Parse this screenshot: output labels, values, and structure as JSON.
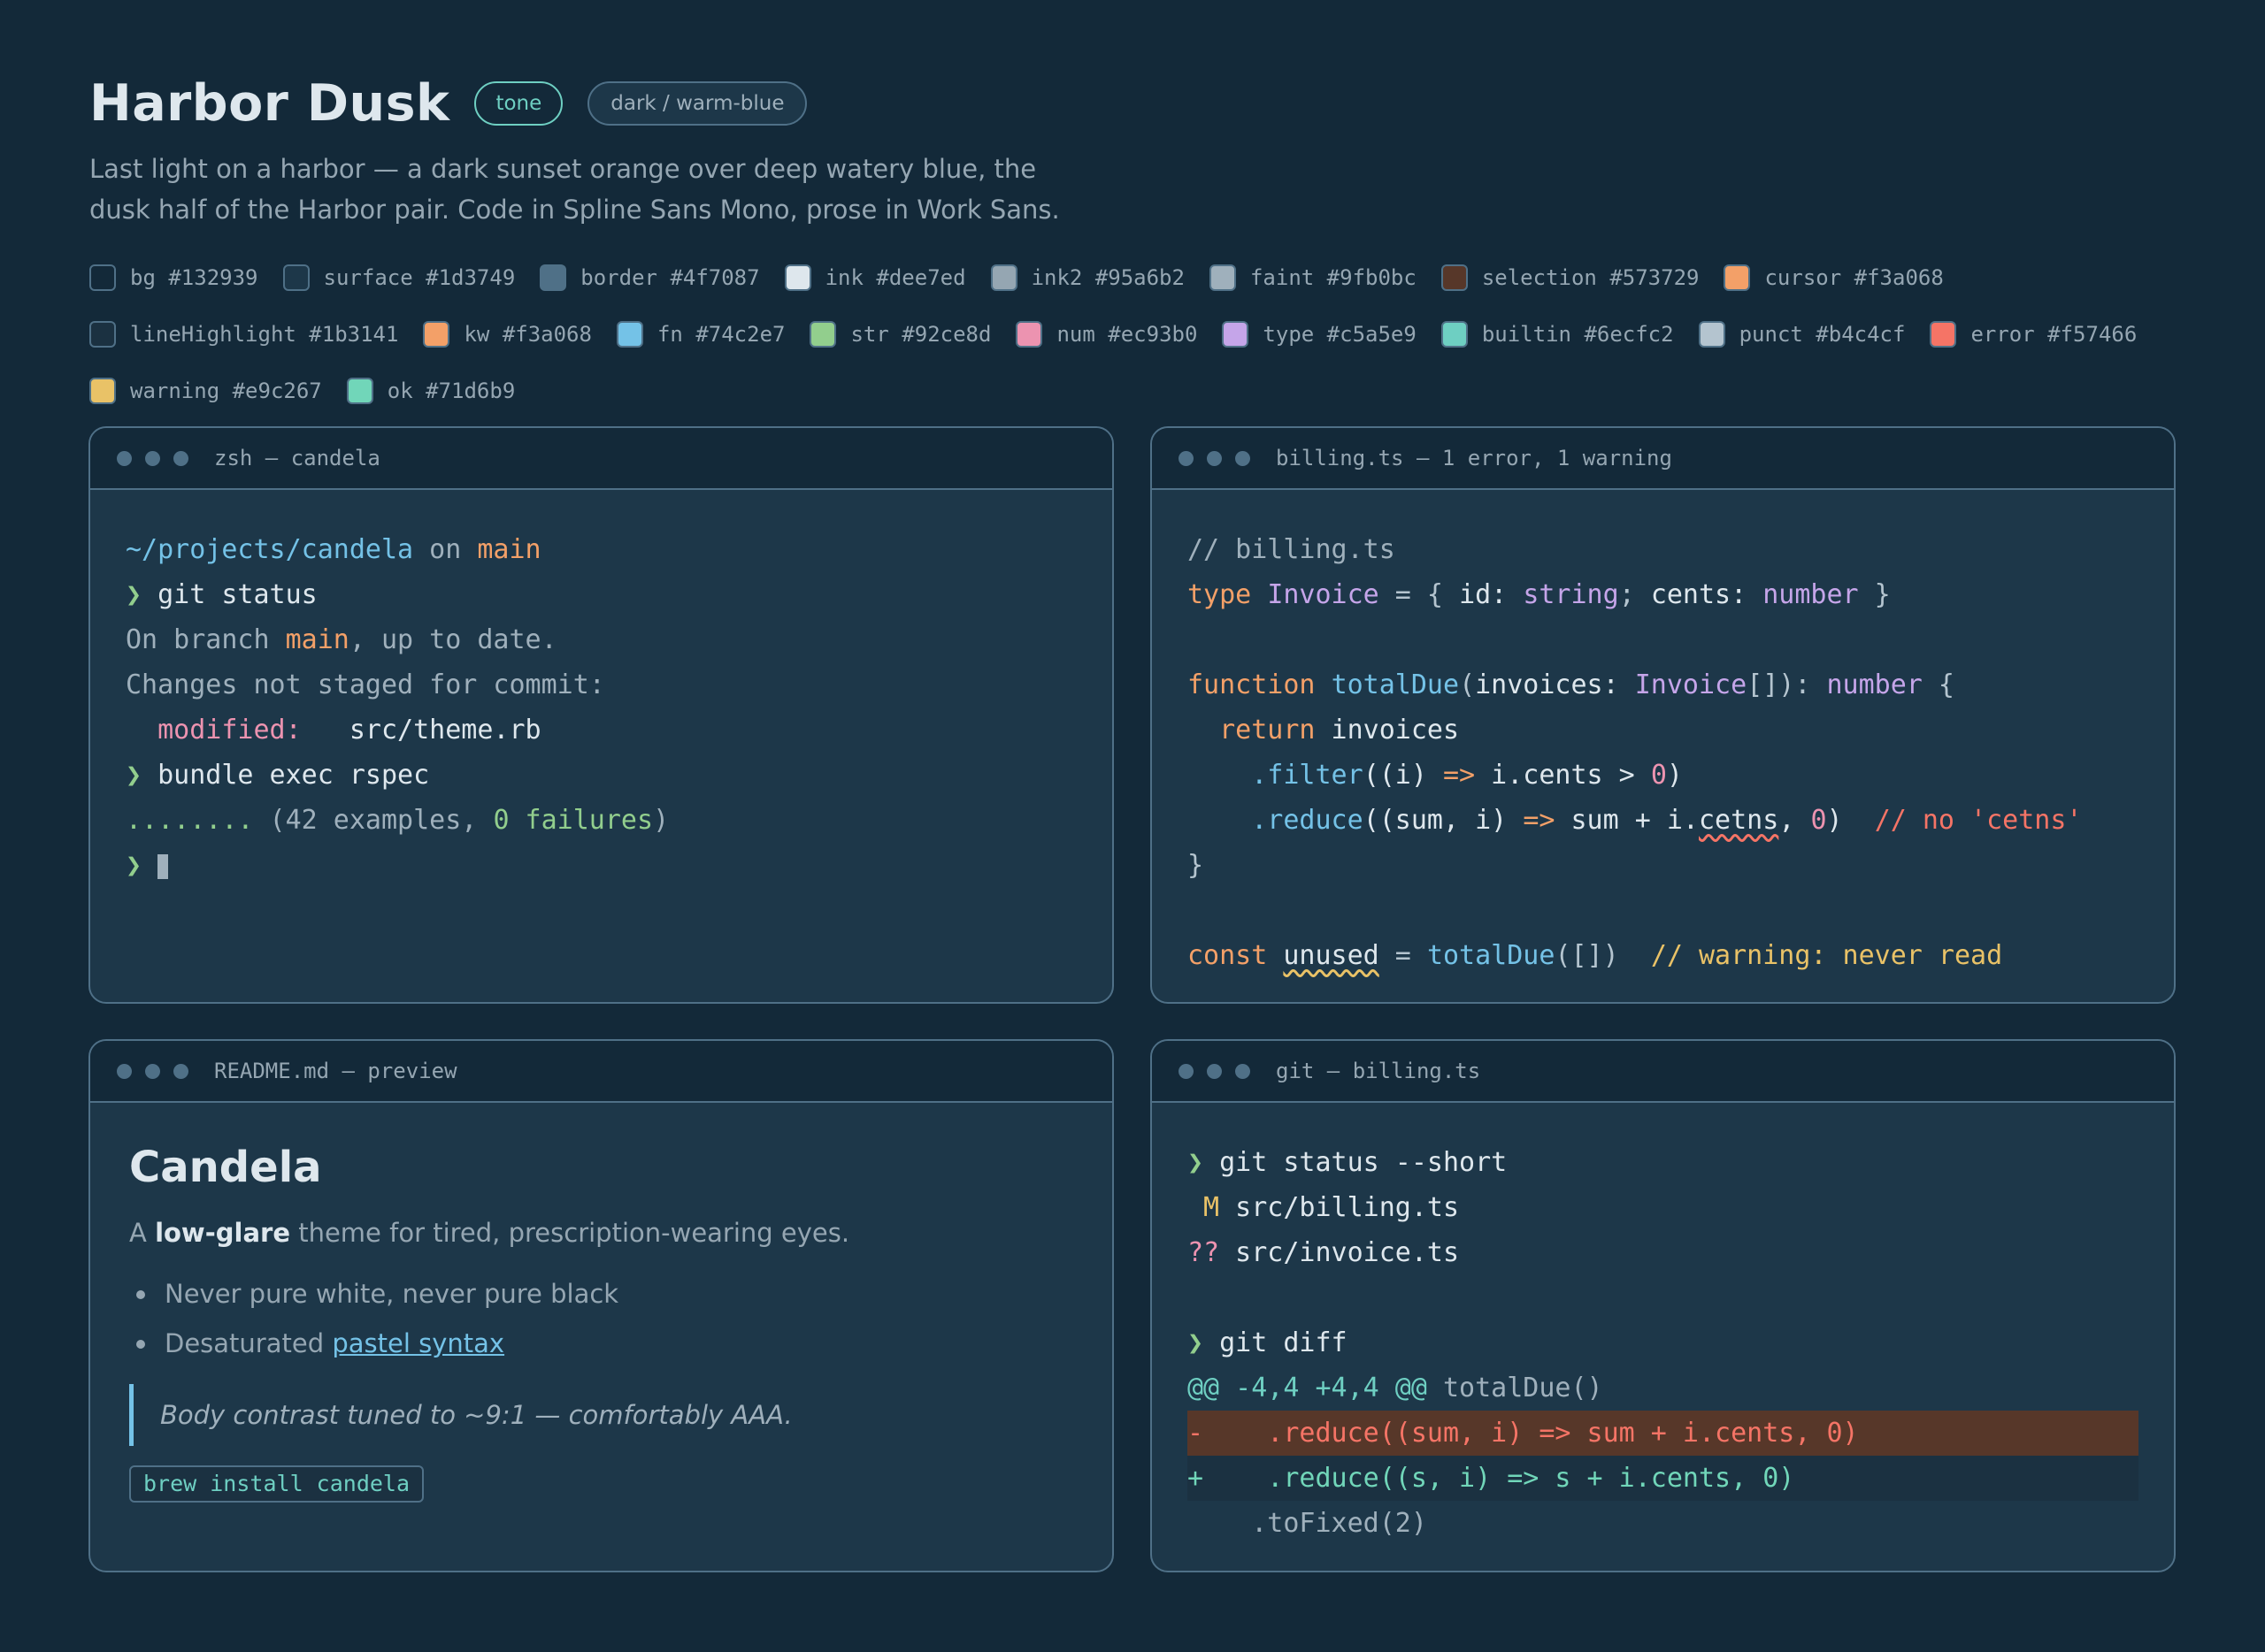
{
  "header": {
    "title": "Harbor Dusk",
    "tone_label": "tone",
    "mode_label": "dark / warm-blue",
    "description_line1": "Last light on a harbor — a dark sunset orange over deep watery blue, the",
    "description_line2": "dusk half of the Harbor pair. Code in Spline Sans Mono, prose in Work Sans."
  },
  "palette": [
    {
      "name": "bg",
      "hex": "#132939"
    },
    {
      "name": "surface",
      "hex": "#1d3749"
    },
    {
      "name": "border",
      "hex": "#4f7087"
    },
    {
      "name": "ink",
      "hex": "#dee7ed"
    },
    {
      "name": "ink2",
      "hex": "#95a6b2"
    },
    {
      "name": "faint",
      "hex": "#9fb0bc"
    },
    {
      "name": "selection",
      "hex": "#573729"
    },
    {
      "name": "cursor",
      "hex": "#f3a068"
    },
    {
      "name": "lineHighlight",
      "hex": "#1b3141"
    },
    {
      "name": "kw",
      "hex": "#f3a068"
    },
    {
      "name": "fn",
      "hex": "#74c2e7"
    },
    {
      "name": "str",
      "hex": "#92ce8d"
    },
    {
      "name": "num",
      "hex": "#ec93b0"
    },
    {
      "name": "type",
      "hex": "#c5a5e9"
    },
    {
      "name": "builtin",
      "hex": "#6ecfc2"
    },
    {
      "name": "punct",
      "hex": "#b4c4cf"
    },
    {
      "name": "error",
      "hex": "#f57466"
    },
    {
      "name": "warning",
      "hex": "#e9c267"
    },
    {
      "name": "ok",
      "hex": "#71d6b9"
    }
  ],
  "terminal": {
    "title": "zsh — candela",
    "path": "~/projects/candela",
    "on": " on ",
    "branch": "main",
    "prompt": "❯ ",
    "cmd1": "git status",
    "l3_a": "On branch ",
    "l3_branch": "main",
    "l3_b": ", up to date.",
    "l4": "Changes not staged for commit:",
    "l5_label": "  modified:",
    "l5_file": "   src/theme.rb",
    "cmd2": "bundle exec rspec",
    "l7_dots": "........",
    "l7_a": " (42 examples, ",
    "l7_ok": "0 failures",
    "l7_b": ")"
  },
  "editor": {
    "title": "billing.ts — 1 error, 1 warning",
    "t": {
      "l1": "// billing.ts",
      "l2_kw": "type",
      "l2_sp": " ",
      "l2_name": "Invoice",
      "l2_eq": " = { ",
      "l2_id": "id: ",
      "l2_str_t": "string",
      "l2_semi": "; ",
      "l2_cents": "cents: ",
      "l2_num_t": "number",
      "l2_end": " }",
      "l4_kw": "function",
      "l4_sp": " ",
      "l4_fn": "totalDue",
      "l4_p1": "(",
      "l4_arg": "invoices: ",
      "l4_type": "Invoice",
      "l4_p2": "[]): ",
      "l4_ret": "number",
      "l4_end": " {",
      "l5_ind": "  ",
      "l5_kw": "return",
      "l5_rest": " invoices",
      "l6_ind": "    ",
      "l6_fn": ".filter",
      "l6_a": "((i) ",
      "l6_arrow": "=>",
      "l6_b": " i.cents > ",
      "l6_num": "0",
      "l6_c": ")",
      "l7_ind": "    ",
      "l7_fn": ".reduce",
      "l7_a": "((sum, i) ",
      "l7_arrow": "=>",
      "l7_b": " sum + i.",
      "l7_bad": "cetns",
      "l7_c": ", ",
      "l7_num": "0",
      "l7_d": ")  ",
      "l7_comment": "// no 'cetns'",
      "l8": "}",
      "l10_kw": "const",
      "l10_sp": " ",
      "l10_name": "unused",
      "l10_eq": " = ",
      "l10_fn": "totalDue",
      "l10_args": "([])  ",
      "l10_comment": "// warning: never read"
    }
  },
  "readme": {
    "title": "README.md — preview",
    "h1": "Candela",
    "p_a": "A ",
    "p_bold": "low-glare",
    "p_b": " theme for tired, prescription-wearing eyes.",
    "li1": "Never pure white, never pure black",
    "li2_a": "Desaturated ",
    "li2_link": "pastel syntax",
    "quote": "Body contrast tuned to ~9:1 — comfortably AAA.",
    "code": "brew install candela"
  },
  "git": {
    "title": "git — billing.ts",
    "prompt": "❯ ",
    "cmd1": "git status --short",
    "s1_flag": " M",
    "s1_file": " src/billing.ts",
    "s2_flag": "??",
    "s2_file": " src/invoice.ts",
    "cmd2": "git diff",
    "hunk": "@@ -4,4 +4,4 @@",
    "hunk_ctx": " totalDue()",
    "del": "-    .reduce((sum, i) => sum + i.cents, 0)",
    "add": "+    .reduce((s, i) => s + i.cents, 0)",
    "ctx": "    .toFixed(2)"
  }
}
